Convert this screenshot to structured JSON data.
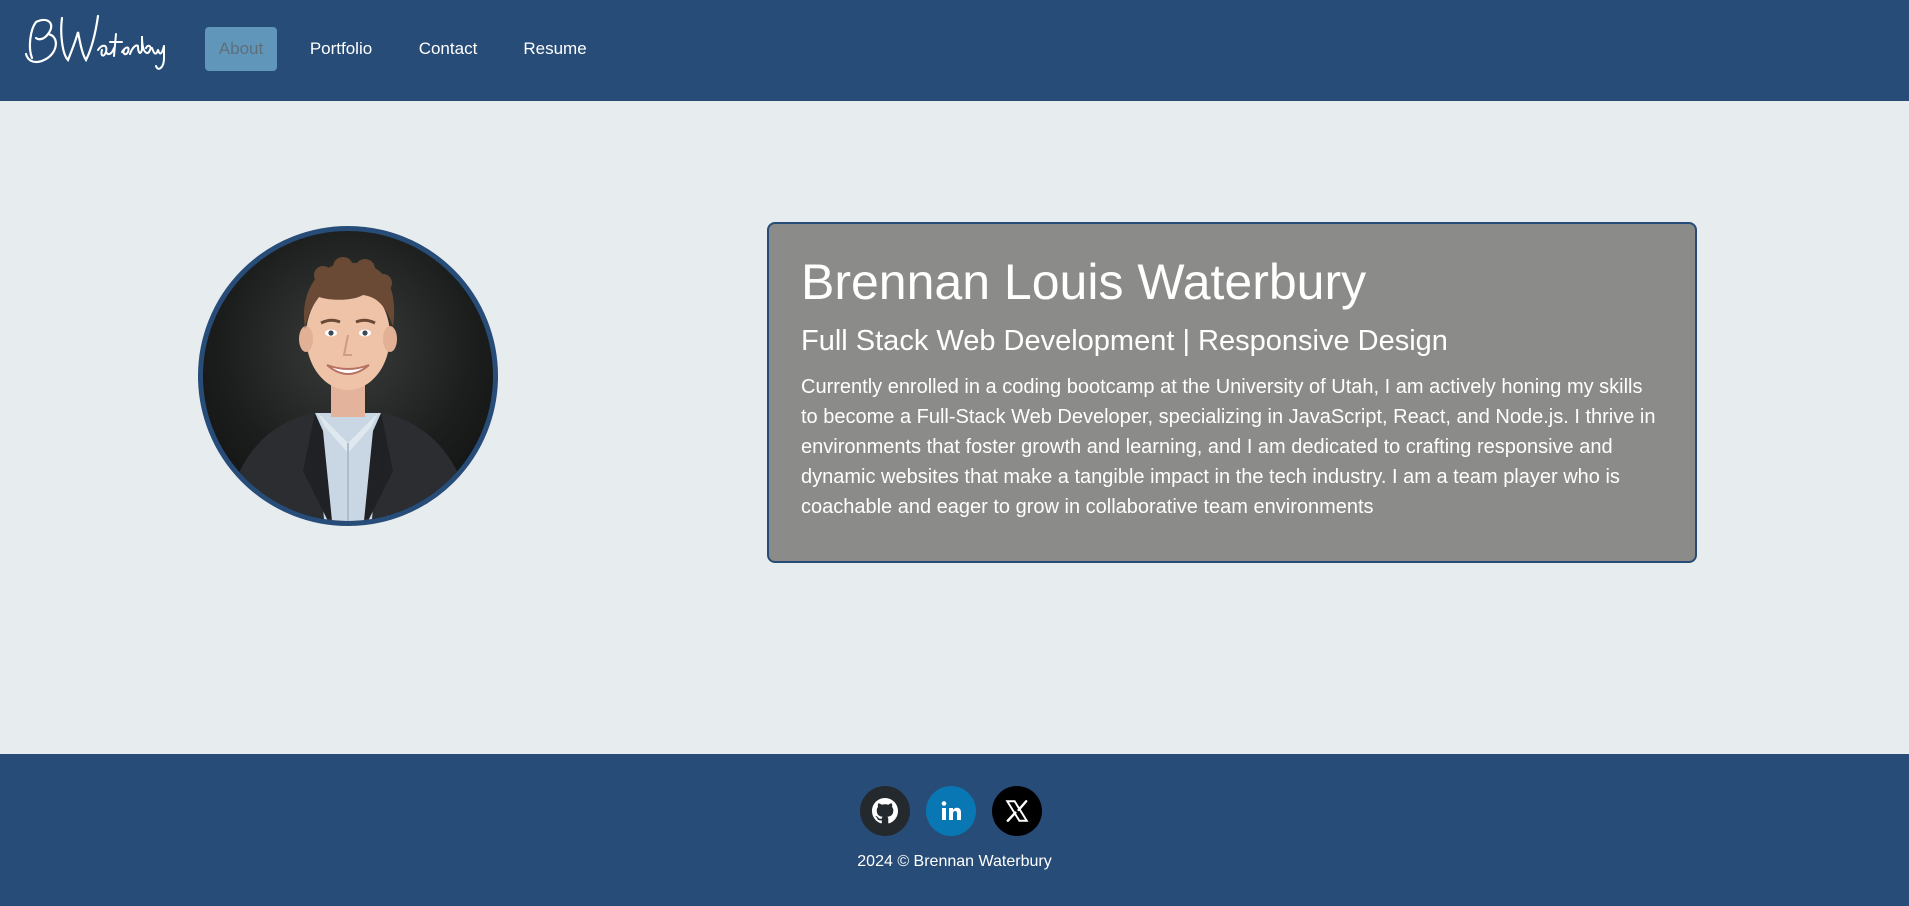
{
  "navbar": {
    "logo_text": "BWaterbury",
    "items": [
      {
        "label": "About",
        "active": true
      },
      {
        "label": "Portfolio",
        "active": false
      },
      {
        "label": "Contact",
        "active": false
      },
      {
        "label": "Resume",
        "active": false
      }
    ]
  },
  "about": {
    "name": "Brennan Louis Waterbury",
    "tagline": "Full Stack Web Development | Responsive Design",
    "bio": "Currently enrolled in a coding bootcamp at the University of Utah, I am actively honing my skills to become a Full-Stack Web Developer, specializing in JavaScript, React, and Node.js. I thrive in environments that foster growth and learning, and I am dedicated to crafting responsive and dynamic websites that make a tangible impact in the tech industry. I am a team player who is coachable and eager to grow in collaborative team environments"
  },
  "footer": {
    "social": [
      {
        "icon": "github-icon",
        "color": "#24292e"
      },
      {
        "icon": "linkedin-icon",
        "color": "#0a77b5"
      },
      {
        "icon": "x-icon",
        "color": "#000000"
      }
    ],
    "copyright": "2024 © Brennan Waterbury"
  },
  "colors": {
    "navbar": "#274c77",
    "active_nav": "#6096ba",
    "background": "#e7ecef",
    "card": "#8b8c89"
  }
}
